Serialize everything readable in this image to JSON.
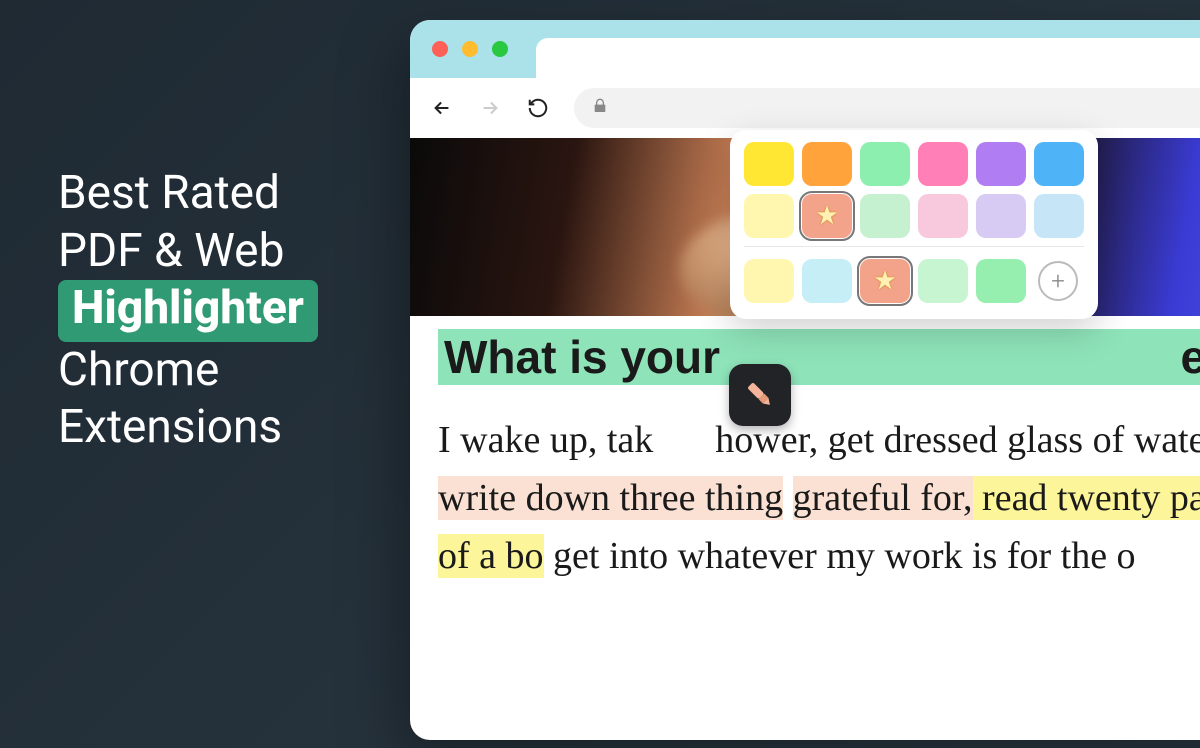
{
  "promo": {
    "line1": "Best Rated",
    "line2": "PDF & Web",
    "highlight": "Highlighter",
    "line4": "Chrome",
    "line5": "Extensions"
  },
  "browser": {
    "newtab_label": "+"
  },
  "article": {
    "heading_before_popup": "What is your",
    "heading_after_popup": "e?",
    "p_prefix": "I wake up, tak",
    "p_after_badge": "hower, get dressed",
    "p_line2_plain": "glass of water, ",
    "p_line2_hl": "write down three thing",
    "p_line3_hl1": "grateful for,",
    "p_line3_hl2": " read twenty pages of a bo",
    "p_line4": "get into whatever my work is for the o"
  },
  "palette": {
    "row1": [
      "#ffe733",
      "#ffa33a",
      "#8cefb0",
      "#ff7fb6",
      "#b07df2",
      "#4fb4f7"
    ],
    "row2": [
      "#fff7b0",
      "#f2a38a",
      "#c6f1d0",
      "#f8c9dd",
      "#d7caf3",
      "#c6e6f7"
    ],
    "row3": [
      "#fff7b0",
      "#c5eef6",
      "#f2a38a",
      "#c7f4d1",
      "#97efaf"
    ],
    "row2_star_index": 1,
    "row3_star_index": 2,
    "add_label": "+"
  }
}
